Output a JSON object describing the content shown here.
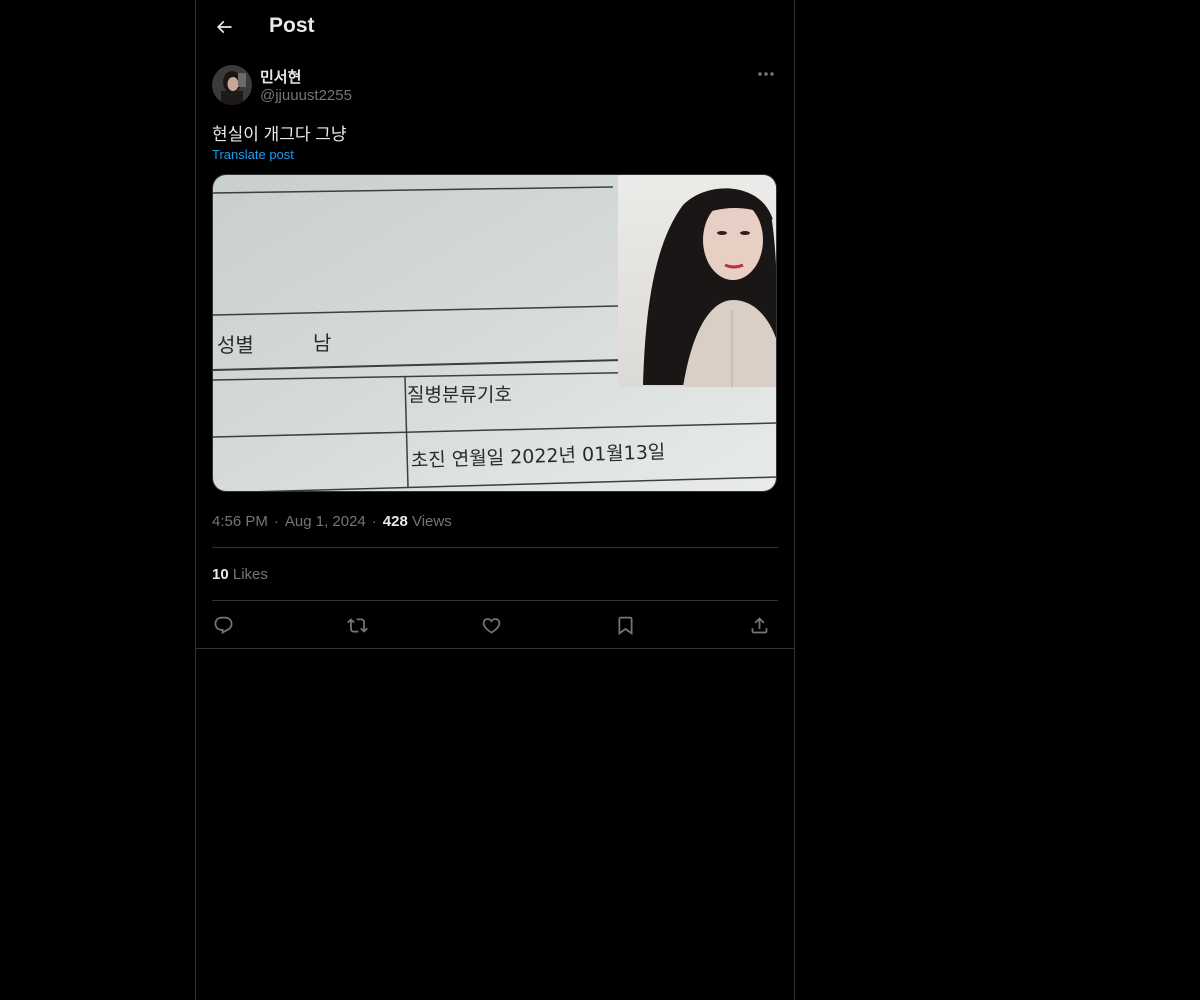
{
  "header": {
    "title": "Post",
    "back_icon": "arrow-left-icon"
  },
  "post": {
    "author": {
      "display_name": "민서현",
      "handle": "@jjuuust2255"
    },
    "text": "현실이 개그다 그냥",
    "translate_label": "Translate post",
    "media": {
      "form_lines": [
        "성별",
        "남",
        "질병분류기호",
        "초진 연월일 2022년 01월13일"
      ]
    },
    "time": "4:56 PM",
    "date": "Aug 1, 2024",
    "views_count": "428",
    "views_label": "Views",
    "likes_count": "10",
    "likes_label": "Likes"
  },
  "actions": [
    {
      "name": "reply",
      "icon": "reply-icon"
    },
    {
      "name": "repost",
      "icon": "repost-icon"
    },
    {
      "name": "like",
      "icon": "heart-icon"
    },
    {
      "name": "bookmark",
      "icon": "bookmark-icon"
    },
    {
      "name": "share",
      "icon": "share-icon"
    }
  ],
  "colors": {
    "background": "#000000",
    "text": "#e7e9ea",
    "muted": "#71767b",
    "link": "#1d9bf0",
    "border": "#2f3336"
  }
}
